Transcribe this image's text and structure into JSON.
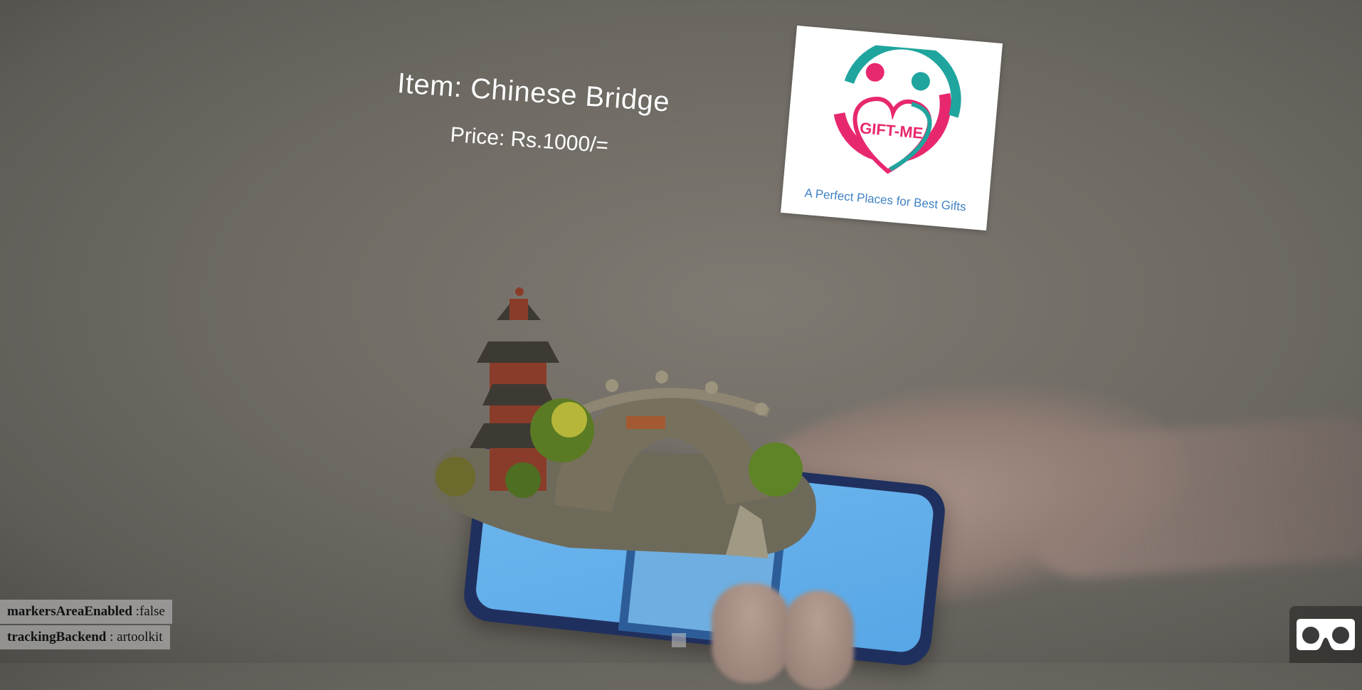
{
  "ar": {
    "item_label": "Item: Chinese Bridge",
    "price_label": "Price: Rs.1000/="
  },
  "logo": {
    "brand": "GIFT-ME",
    "tagline": "A Perfect Places for Best Gifts"
  },
  "debug": {
    "markers_key": "markersAreaEnabled",
    "markers_value": " :false",
    "tracking_key": "trackingBackend",
    "tracking_value": " : artoolkit"
  },
  "colors": {
    "logo_pink": "#e8286e",
    "logo_teal": "#1fa59e",
    "tagline_blue": "#3f82c4"
  },
  "icons": {
    "vr": "vr-headset-icon"
  }
}
